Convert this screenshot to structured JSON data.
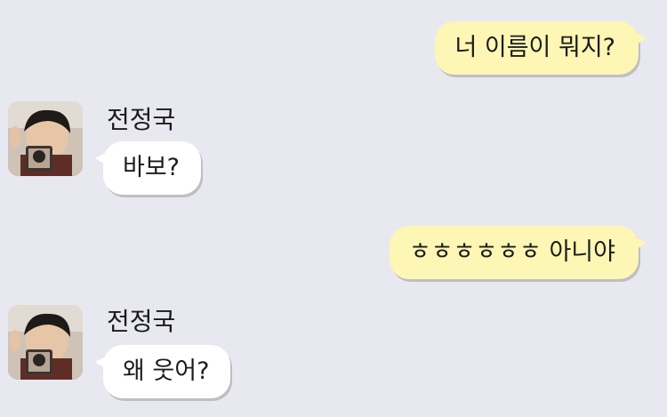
{
  "colors": {
    "background": "#e8e8f0",
    "outgoing_bubble": "#fdf6b4",
    "incoming_bubble": "#ffffff"
  },
  "messages": [
    {
      "direction": "outgoing",
      "text": "너 이름이 뭐지?"
    },
    {
      "direction": "incoming",
      "sender": "전정국",
      "text": "바보?",
      "avatar_icon": "profile-photo-icon"
    },
    {
      "direction": "outgoing",
      "text": "ㅎㅎㅎㅎㅎㅎ 아니야"
    },
    {
      "direction": "incoming",
      "sender": "전정국",
      "text": "왜 웃어?",
      "avatar_icon": "profile-photo-icon"
    }
  ]
}
